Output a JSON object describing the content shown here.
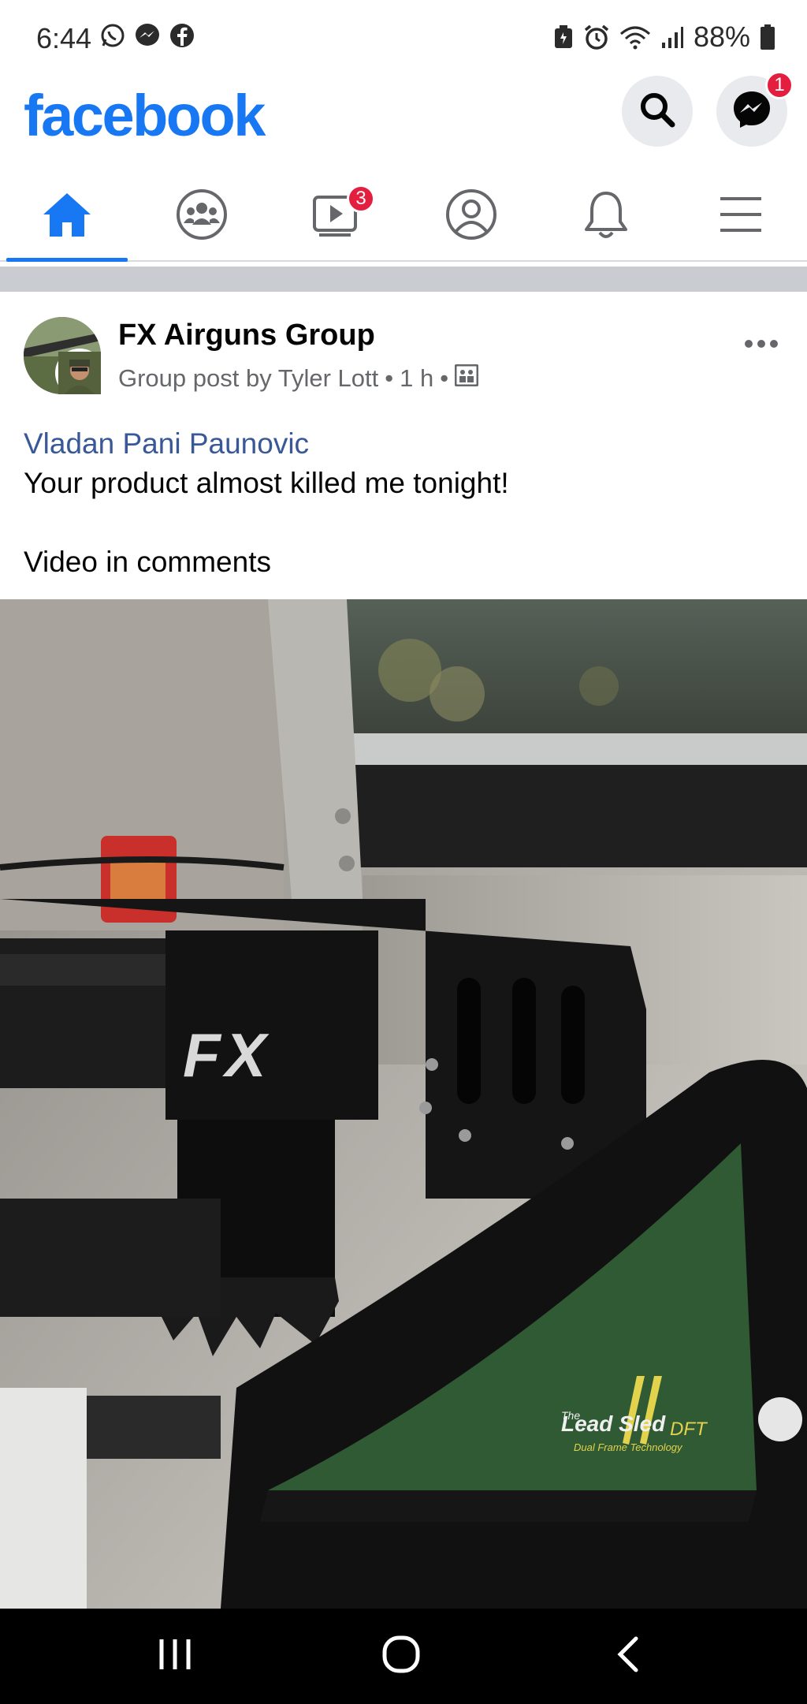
{
  "status_bar": {
    "time": "6:44",
    "battery": "88%",
    "left_icons": [
      "whatsapp-icon",
      "messenger-icon",
      "facebook-icon"
    ],
    "right_icons": [
      "battery-saver-icon",
      "alarm-icon",
      "wifi-icon",
      "signal-icon",
      "battery-icon"
    ]
  },
  "header": {
    "logo": "facebook",
    "messenger_badge": "1",
    "brand_color": "#1877f2"
  },
  "nav": {
    "tabs": [
      {
        "name": "home",
        "icon": "home-icon",
        "active": true
      },
      {
        "name": "groups",
        "icon": "groups-icon"
      },
      {
        "name": "watch",
        "icon": "video-icon",
        "badge": "3"
      },
      {
        "name": "profile",
        "icon": "profile-icon"
      },
      {
        "name": "notifications",
        "icon": "bell-icon"
      },
      {
        "name": "menu",
        "icon": "menu-icon"
      }
    ]
  },
  "post": {
    "group_name": "FX Airguns Group",
    "meta": "Group post by Tyler Lott",
    "time": "1 h",
    "privacy_icon": "private-group-icon",
    "mention": "Vladan Pani Paunovic",
    "line1": "Your product almost killed me tonight!",
    "line2": "Video in comments",
    "photo": {
      "brand_text": "FX",
      "sled_brand": "Lead Sled",
      "sled_small_top": "The",
      "sled_suffix": "DFT",
      "sled_tagline": "Dual Frame Technology"
    }
  },
  "system_nav": [
    "recents-icon",
    "home-circle-icon",
    "back-icon"
  ]
}
